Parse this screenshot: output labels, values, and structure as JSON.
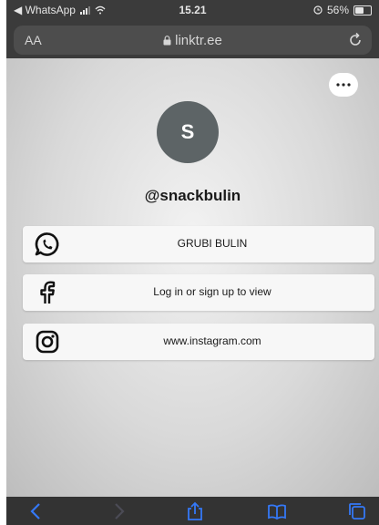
{
  "status_bar": {
    "back_app": "◀ WhatsApp",
    "time": "15.21",
    "battery": "56%",
    "battery_level": 0.56
  },
  "address_bar": {
    "text_size_label": "AA",
    "url": "linktr.ee"
  },
  "profile": {
    "avatar_initial": "S",
    "username": "@snackbulin"
  },
  "links": [
    {
      "label": "GRUBI BULIN",
      "icon": "whatsapp-icon"
    },
    {
      "label": "Log in or sign up to view",
      "icon": "facebook-icon"
    },
    {
      "label": "www.instagram.com",
      "icon": "instagram-icon"
    }
  ],
  "toolbar": {
    "buttons": [
      "back-icon",
      "forward-icon",
      "share-icon",
      "bookmarks-icon",
      "tabs-icon"
    ]
  },
  "colors": {
    "browser_chrome": "#3b3b3b",
    "toolbar_accent": "#3478f6",
    "avatar_bg": "#5d6466"
  }
}
